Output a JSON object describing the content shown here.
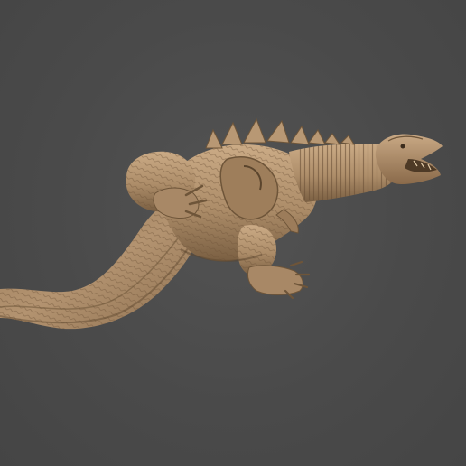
{
  "scene": {
    "background_color": "#4a4a4a",
    "model_color": "#b0906c",
    "model_shadow_color": "#6e5539",
    "model_highlight_color": "#d4b896",
    "subject": "creature-sculpt-render"
  }
}
